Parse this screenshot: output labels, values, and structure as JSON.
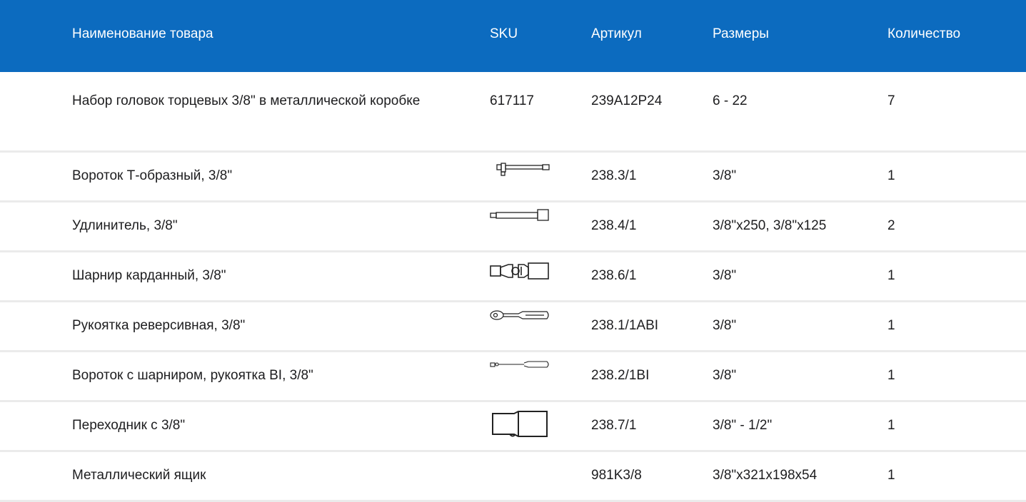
{
  "header": {
    "name": "Наименование товара",
    "sku": "SKU",
    "article": "Артикул",
    "sizes": "Размеры",
    "qty": "Количество"
  },
  "rows": [
    {
      "name": "Набор головок торцевых 3/8\" в металлической коробке",
      "sku": "617117",
      "article": "239A12P24",
      "sizes": "6 - 22",
      "qty": "7"
    },
    {
      "name": "Вороток Т-образный, 3/8\"",
      "sku_icon": "t-handle-icon",
      "article": "238.3/1",
      "sizes": "3/8\"",
      "qty": "1"
    },
    {
      "name": "Удлинитель, 3/8\"",
      "sku_icon": "extension-bar-icon",
      "article": "238.4/1",
      "sizes": "3/8\"x250, 3/8\"x125",
      "qty": "2"
    },
    {
      "name": "Шарнир карданный, 3/8\"",
      "sku_icon": "universal-joint-icon",
      "article": "238.6/1",
      "sizes": "3/8\"",
      "qty": "1"
    },
    {
      "name": "Рукоятка реверсивная, 3/8\"",
      "sku_icon": "ratchet-handle-icon",
      "article": "238.1/1ABI",
      "sizes": "3/8\"",
      "qty": "1"
    },
    {
      "name": "Вороток с шарниром, рукоятка BI, 3/8\"",
      "sku_icon": "flex-handle-icon",
      "article": "238.2/1BI",
      "sizes": "3/8\"",
      "qty": "1"
    },
    {
      "name": "Переходник с 3/8\"",
      "sku_icon": "adapter-icon",
      "article": "238.7/1",
      "sizes": "3/8\" - 1/2\"",
      "qty": "1"
    },
    {
      "name": "Металлический ящик",
      "sku": "",
      "article": "981K3/8",
      "sizes": "3/8\"x321x198x54",
      "qty": "1"
    }
  ],
  "colors": {
    "header_bg": "#0c6bbf",
    "header_text": "#ffffff",
    "row_divider": "#ebebeb"
  }
}
